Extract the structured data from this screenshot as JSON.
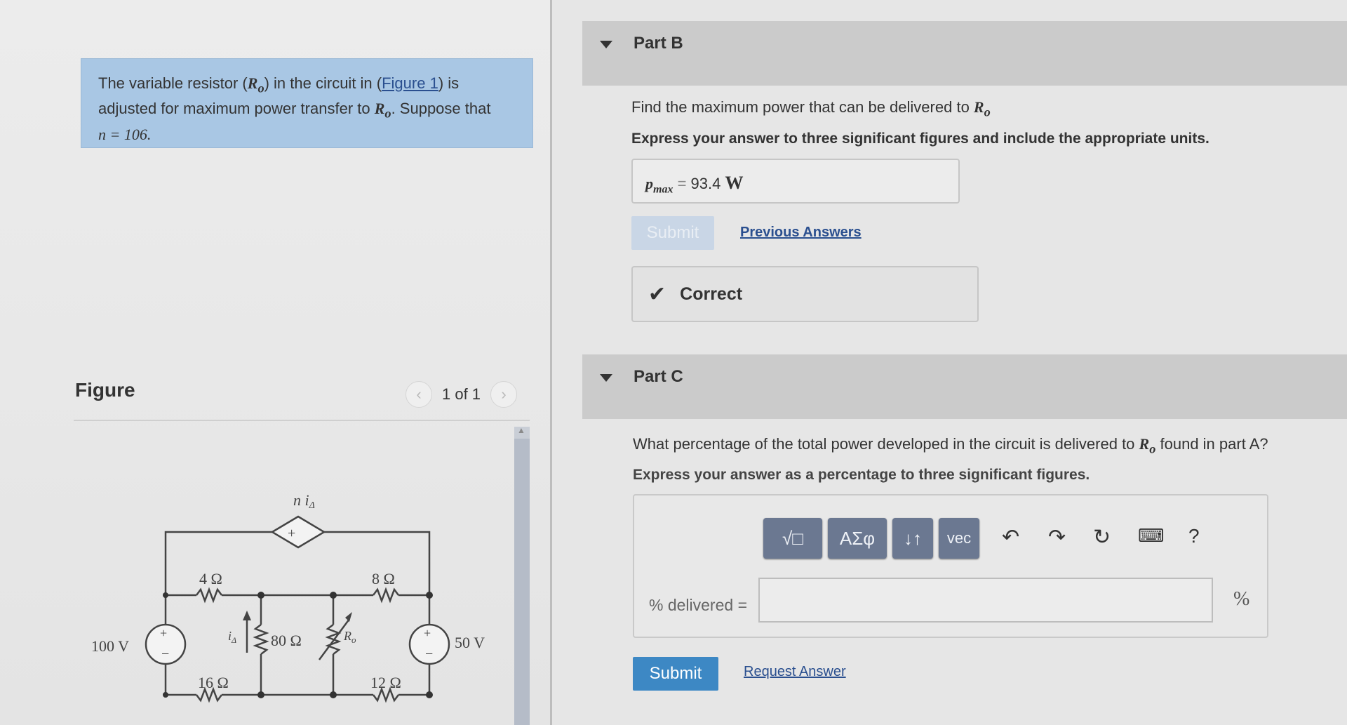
{
  "problem": {
    "text_before": "The variable resistor (",
    "var": "R",
    "sub": "o",
    "text_mid": ") in the circuit in (",
    "figure_link": "Figure 1",
    "text_after": ") is adjusted for maximum power transfer to ",
    "text_suppose": ". Suppose that",
    "n_line": "n = 106."
  },
  "figure": {
    "title": "Figure",
    "pager": "1 of 1",
    "prev_icon": "chevron-left",
    "next_icon": "chevron-right"
  },
  "circuit": {
    "src_left": "100 V",
    "src_right": "50 V",
    "r1": "4 Ω",
    "r2": "16 Ω",
    "r3": "80 Ω",
    "r4": "8 Ω",
    "r5": "12 Ω",
    "ro": "R",
    "ro_sub": "o",
    "dep": "n i",
    "dep_sub": "Δ",
    "i_label": "i",
    "i_sub": "Δ",
    "plus": "+",
    "minus": "−"
  },
  "partB": {
    "label": "Part B",
    "question": "Find the maximum power that can be delivered to ",
    "instruction": "Express your answer to three significant figures and include the appropriate units.",
    "answer_symbol": "p",
    "answer_sub": "max",
    "answer_eq": " = ",
    "answer_value": "93.4",
    "answer_unit": "W",
    "submit": "Submit",
    "previous": "Previous Answers",
    "feedback": "Correct"
  },
  "partC": {
    "label": "Part C",
    "question_a": "What percentage of the total power developed in the circuit is delivered to ",
    "question_b": " found in part A?",
    "instruction": "Express your answer as a percentage to three significant figures.",
    "input_label": "% delivered =",
    "unit": "%",
    "submit": "Submit",
    "request": "Request Answer",
    "toolbar": {
      "templates": "√□",
      "greek": "ΑΣφ",
      "arrows": "↓↑",
      "vec": "vec",
      "undo_icon": "undo",
      "redo_icon": "redo",
      "reset_icon": "reset",
      "keyboard_icon": "keyboard",
      "help": "?"
    }
  },
  "colors": {
    "problem_bg": "#a9c7e4",
    "header_bg": "#cbcbcb",
    "submit_active": "#3d88c4",
    "tool_bg": "#6b7891"
  }
}
